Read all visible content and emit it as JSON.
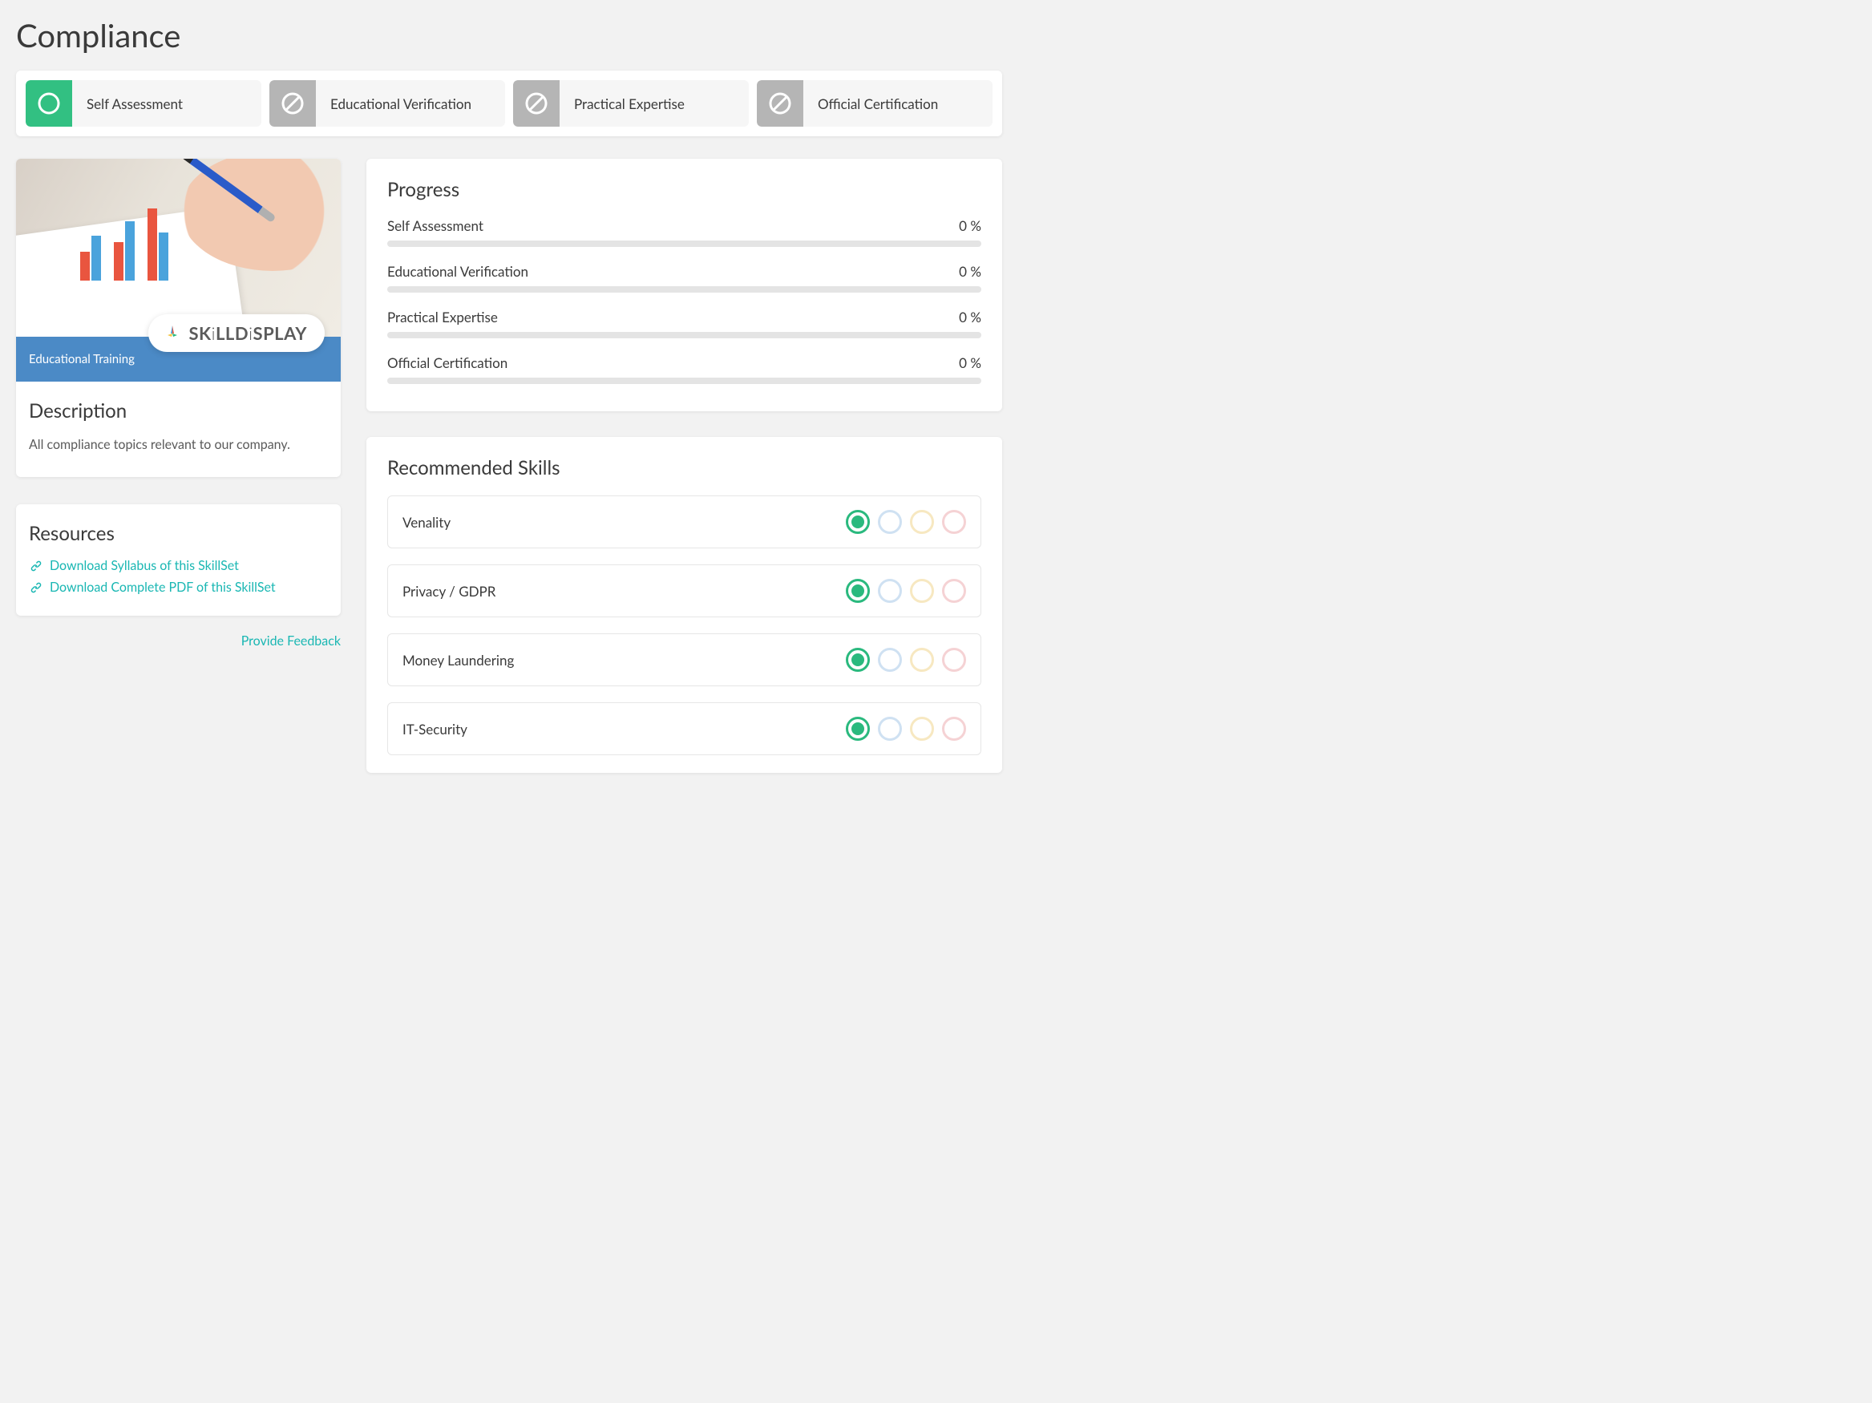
{
  "page": {
    "title": "Compliance"
  },
  "verificationTabs": [
    {
      "label": "Self Assessment",
      "state": "active"
    },
    {
      "label": "Educational Verification",
      "state": "disabled"
    },
    {
      "label": "Practical Expertise",
      "state": "disabled"
    },
    {
      "label": "Official Certification",
      "state": "disabled"
    }
  ],
  "training": {
    "bandLabel": "Educational Training",
    "brand": "SKiLLDiSPLAY",
    "descriptionHeading": "Description",
    "descriptionText": "All compliance topics relevant to our company."
  },
  "resources": {
    "heading": "Resources",
    "links": [
      "Download Syllabus of this SkillSet",
      "Download Complete PDF of this SkillSet"
    ],
    "feedback": "Provide Feedback"
  },
  "progress": {
    "heading": "Progress",
    "items": [
      {
        "label": "Self Assessment",
        "value": "0 %"
      },
      {
        "label": "Educational Verification",
        "value": "0 %"
      },
      {
        "label": "Practical Expertise",
        "value": "0 %"
      },
      {
        "label": "Official Certification",
        "value": "0 %"
      }
    ]
  },
  "skills": {
    "heading": "Recommended Skills",
    "items": [
      {
        "name": "Venality"
      },
      {
        "name": "Privacy / GDPR"
      },
      {
        "name": "Money Laundering"
      },
      {
        "name": "IT-Security"
      }
    ]
  },
  "colors": {
    "accentGreen": "#32c082",
    "linkTeal": "#1ab7b3",
    "bandBlue": "#4b8ac6"
  }
}
